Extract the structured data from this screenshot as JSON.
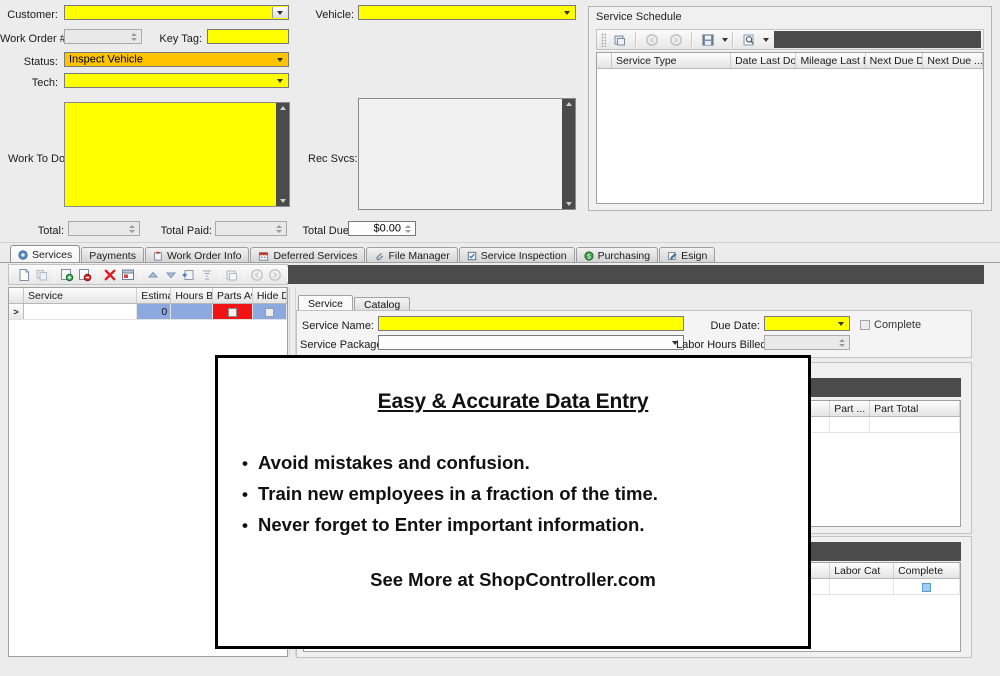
{
  "header": {
    "customer_label": "Customer:",
    "customer_value": "",
    "work_order_label": "Work Order #:",
    "work_order_value": "",
    "key_tag_label": "Key Tag:",
    "key_tag_value": "",
    "status_label": "Status:",
    "status_value": "Inspect Vehicle",
    "tech_label": "Tech:",
    "tech_value": "",
    "vehicle_label": "Vehicle:",
    "vehicle_value": "",
    "work_to_do_label": "Work To Do:",
    "work_to_do_value": "",
    "rec_svcs_label": "Rec Svcs:",
    "rec_svcs_value": "",
    "total_label": "Total:",
    "total_value": "",
    "total_paid_label": "Total Paid:",
    "total_paid_value": "",
    "total_due_label": "Total Due:",
    "total_due_value": "$0.00"
  },
  "service_schedule": {
    "title": "Service Schedule",
    "columns": [
      "Service Type",
      "Date Last Done",
      "Mileage Last Done",
      "Next Due Date",
      "Next Due ..."
    ],
    "rows": [],
    "sort_indicator": "ascending"
  },
  "main_tabs": [
    {
      "label": "Services",
      "icon": "gear-icon",
      "active": true
    },
    {
      "label": "Payments",
      "icon": "",
      "active": false
    },
    {
      "label": "Work Order Info",
      "icon": "clipboard-icon",
      "active": false
    },
    {
      "label": "Deferred Services",
      "icon": "calendar-icon",
      "active": false
    },
    {
      "label": "File Manager",
      "icon": "paperclip-icon",
      "active": false
    },
    {
      "label": "Service Inspection",
      "icon": "inspection-icon",
      "active": false
    },
    {
      "label": "Purchasing",
      "icon": "dollar-icon",
      "active": false
    },
    {
      "label": "Esign",
      "icon": "pen-icon",
      "active": false
    }
  ],
  "services_toolbar": [
    "new-icon",
    "copy-icon",
    "add-record-icon",
    "remove-record-icon",
    "delete-icon",
    "window-icon",
    "move-up-icon",
    "move-down-icon",
    "indent-icon",
    "collapse-icon",
    "detail-icon",
    "back-icon",
    "forward-icon",
    "save-icon",
    "save-dropdown",
    "find-icon",
    "find-dropdown"
  ],
  "services_grid": {
    "columns": [
      "Service",
      "Estima...",
      "Hours Bil...",
      "Parts Av...",
      "Hide D..."
    ],
    "rows": [
      {
        "indicator": ">",
        "service": "",
        "estimate": "0",
        "hours_billed": "",
        "parts_available": "checkbox",
        "hide_detail": "checkbox"
      }
    ]
  },
  "detail_tabs": [
    {
      "label": "Service",
      "active": true
    },
    {
      "label": "Catalog",
      "active": false
    }
  ],
  "detail_form": {
    "service_name_label": "Service Name:",
    "service_name_value": "",
    "service_package_label": "Service Package:",
    "service_package_value": "",
    "due_date_label": "Due Date:",
    "due_date_value": "",
    "complete_label": "Complete",
    "complete_checked": false,
    "labor_hours_label": "Labor Hours Billed:",
    "labor_hours_value": ""
  },
  "parts_grid": {
    "columns": [
      "Part ...",
      "Part Total"
    ],
    "rows": [
      {
        "part": "",
        "part_total": ""
      }
    ]
  },
  "labor_grid": {
    "columns": [
      "Labor Cat",
      "Complete"
    ],
    "rows": [
      {
        "labor_cat": "",
        "complete": "checkbox-selected"
      }
    ]
  },
  "overlay": {
    "title": "Easy & Accurate Data Entry",
    "bullets": [
      "Avoid mistakes and confusion.",
      "Train new employees in a fraction of the time.",
      "Never forget to Enter important information."
    ],
    "cta": "See More at ShopController.com"
  },
  "colors": {
    "required_field": "#ffff00",
    "status_field": "#ffc400",
    "grid_highlight": "#8ca9e0",
    "grid_alert": "#f01414",
    "toolbar_fill": "#4b4b4b",
    "window_bg": "#ececec"
  }
}
